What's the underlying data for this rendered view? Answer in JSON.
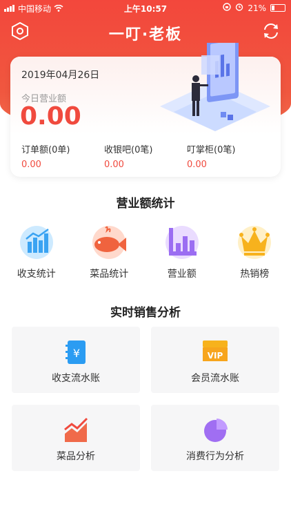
{
  "status_bar": {
    "carrier": "中国移动",
    "time": "上午10:57",
    "battery": "21%"
  },
  "header": {
    "logo_text": "一叮·老板",
    "left_icon": "settings-hexagon-icon",
    "right_icon": "refresh-icon"
  },
  "summary": {
    "date": "2019年04月26日",
    "revenue_label": "今日营业额",
    "revenue_value": "0.00",
    "metrics": [
      {
        "label": "订单额(0单)",
        "value": "0.00"
      },
      {
        "label": "收银吧(0笔)",
        "value": "0.00"
      },
      {
        "label": "叮掌柜(0笔)",
        "value": "0.00"
      }
    ]
  },
  "revenue_stats": {
    "title": "营业额统计",
    "items": [
      {
        "label": "收支统计",
        "icon": "bar-chart-icon"
      },
      {
        "label": "菜品统计",
        "icon": "fish-icon"
      },
      {
        "label": "营业额",
        "icon": "column-chart-icon"
      },
      {
        "label": "热销榜",
        "icon": "crown-icon"
      }
    ]
  },
  "sales_analysis": {
    "title": "实时销售分析",
    "tiles": [
      {
        "label": "收支流水账",
        "icon": "ledger-yen-icon",
        "icon_text": "¥"
      },
      {
        "label": "会员流水账",
        "icon": "vip-card-icon",
        "icon_text": "VIP"
      },
      {
        "label": "菜品分析",
        "icon": "trend-chart-icon"
      },
      {
        "label": "消费行为分析",
        "icon": "pie-chart-icon"
      }
    ]
  },
  "colors": {
    "brand_red": "#f04a3e",
    "header_red": "#f3473c"
  }
}
